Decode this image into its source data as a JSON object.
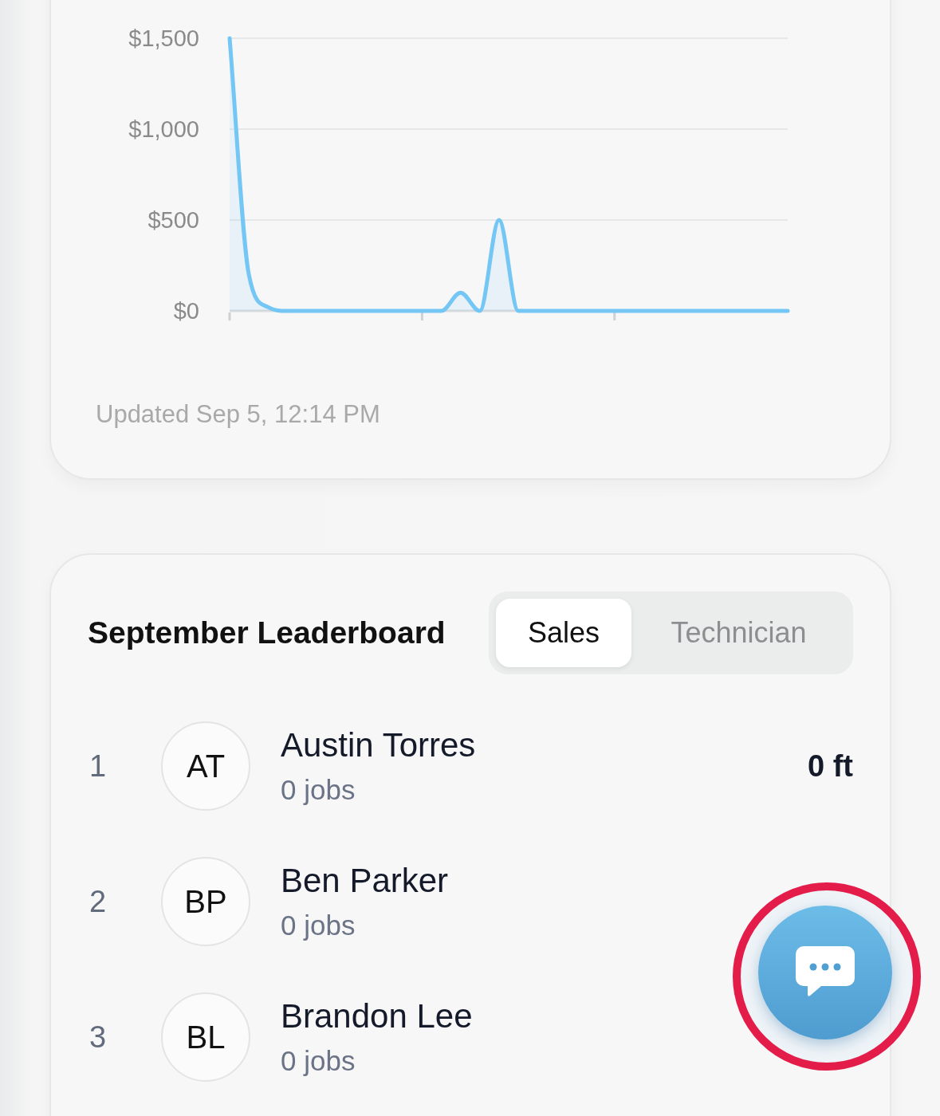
{
  "revenue_card": {
    "chart_data": {
      "type": "area",
      "ylim": [
        0,
        1500
      ],
      "yticks": [
        {
          "value": 0,
          "label": "$0"
        },
        {
          "value": 500,
          "label": "$500"
        },
        {
          "value": 1000,
          "label": "$1,000"
        },
        {
          "value": 1500,
          "label": "$1,500"
        }
      ],
      "series": [
        {
          "color": "#74c6f5",
          "values": [
            1500,
            200,
            20,
            0,
            0,
            0,
            0,
            0,
            0,
            0,
            0,
            0,
            100,
            0,
            500,
            0,
            0,
            0,
            0,
            0,
            0,
            0,
            0,
            0,
            0,
            0,
            0,
            0,
            0,
            0
          ]
        }
      ]
    },
    "updated": "Updated Sep 5, 12:14 PM"
  },
  "leaderboard": {
    "title": "September Leaderboard",
    "tabs": [
      {
        "label": "Sales",
        "selected": true
      },
      {
        "label": "Technician",
        "selected": false
      }
    ],
    "rows": [
      {
        "rank": "1",
        "initials": "AT",
        "name": "Austin Torres",
        "jobs": "0 jobs",
        "value": "0 ft"
      },
      {
        "rank": "2",
        "initials": "BP",
        "name": "Ben Parker",
        "jobs": "0 jobs"
      },
      {
        "rank": "3",
        "initials": "BL",
        "name": "Brandon Lee",
        "jobs": "0 jobs"
      }
    ]
  },
  "chat_button": {
    "highlighted": true
  }
}
